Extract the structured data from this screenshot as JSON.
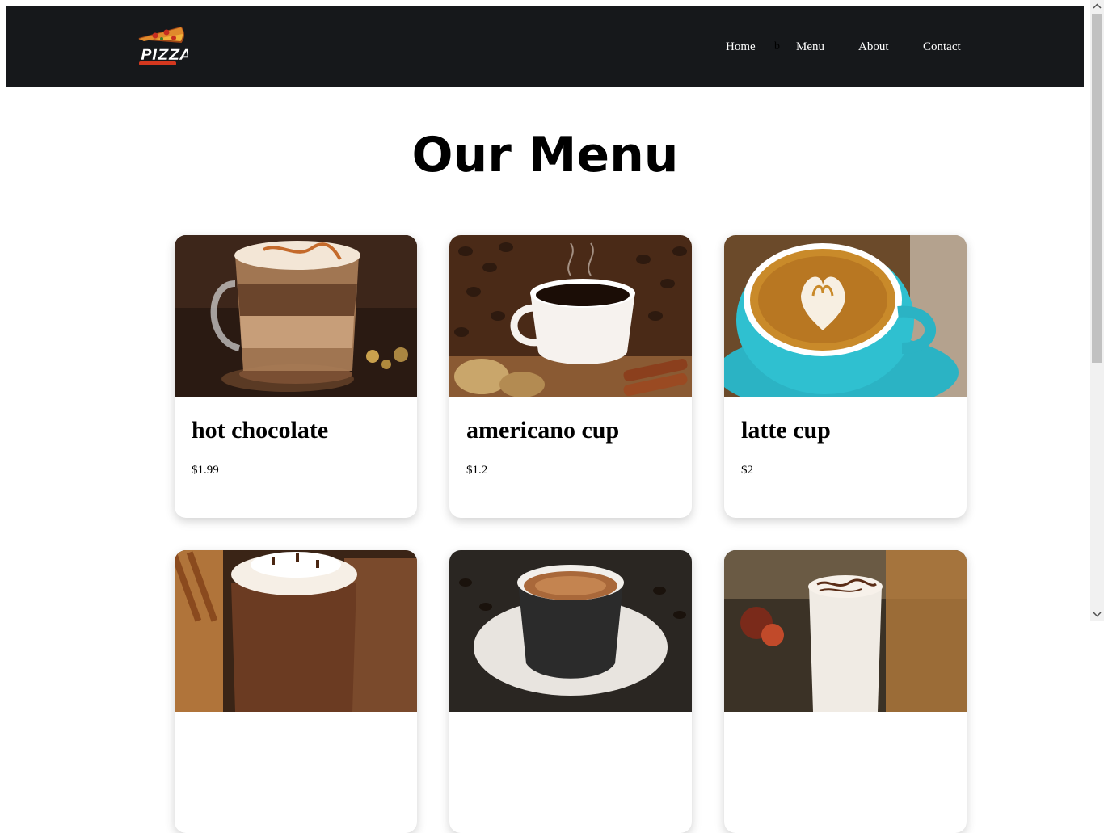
{
  "header": {
    "logo_text": "PIZZA",
    "nav": [
      {
        "label": "Home"
      },
      {
        "label": "Menu"
      },
      {
        "label": "About"
      },
      {
        "label": "Contact"
      }
    ],
    "stray_glyph": "b"
  },
  "main": {
    "title": "Our Menu",
    "items": [
      {
        "name": "hot chocolate",
        "price": "$1.99"
      },
      {
        "name": "americano cup",
        "price": "$1.2"
      },
      {
        "name": "latte cup",
        "price": "$2"
      },
      {
        "name": "",
        "price": ""
      },
      {
        "name": "",
        "price": ""
      },
      {
        "name": "",
        "price": ""
      }
    ]
  },
  "colors": {
    "navbar_bg": "#16181b",
    "nav_text": "#ffffff",
    "page_bg": "#ffffff",
    "latte_cup_blue": "#2bb3c4"
  }
}
